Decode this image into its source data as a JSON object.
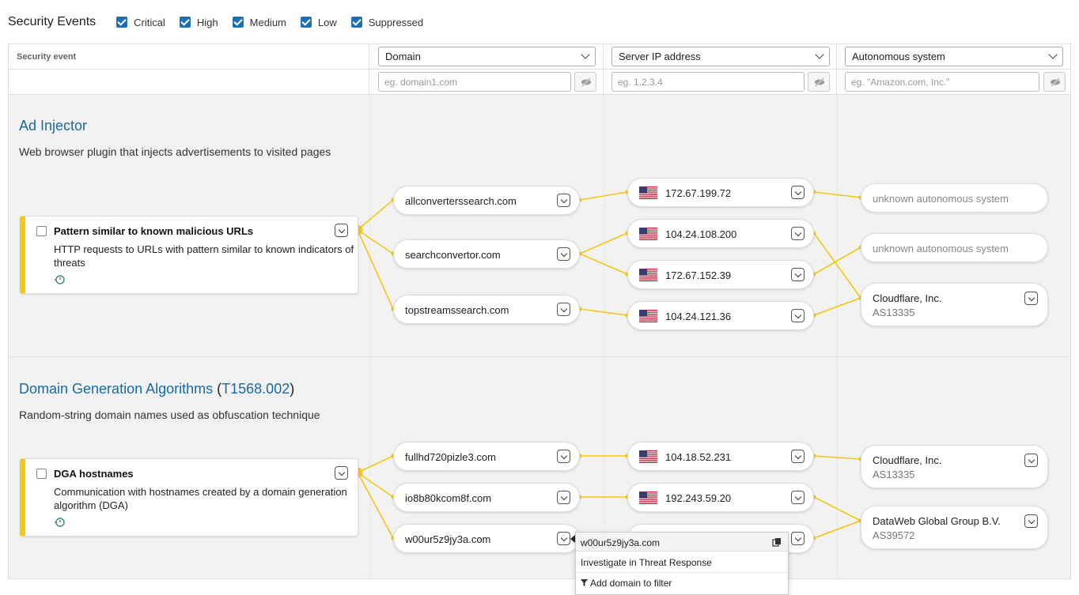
{
  "header": {
    "title": "Security Events",
    "filters": [
      "Critical",
      "High",
      "Medium",
      "Low",
      "Suppressed"
    ]
  },
  "table": {
    "col_security_event": "Security event",
    "col_domain": "Domain",
    "col_server_ip": "Server IP address",
    "col_as": "Autonomous system",
    "ph_domain": "eg. domain1.com",
    "ph_ip": "eg. 1.2.3.4",
    "ph_as": "eg. \"Amazon.com, Inc.\""
  },
  "sections": [
    {
      "title": "Ad Injector",
      "description": "Web browser plugin that injects advertisements to visited pages",
      "event": {
        "name": "Pattern similar to known malicious URLs",
        "description": "HTTP requests to URLs with pattern similar to known indicators of threats"
      },
      "domains": [
        "allconverterssearch.com",
        "searchconvertor.com",
        "topstreamssearch.com"
      ],
      "ips": [
        "172.67.199.72",
        "104.24.108.200",
        "172.67.152.39",
        "104.24.121.36"
      ],
      "as": [
        {
          "name": "unknown autonomous system",
          "num": ""
        },
        {
          "name": "unknown autonomous system",
          "num": ""
        },
        {
          "name": "Cloudflare, Inc.",
          "num": "AS13335"
        }
      ]
    },
    {
      "title": "Domain Generation Algorithms",
      "title_link": "T1568.002",
      "title_open": "(",
      "title_close": ")",
      "description": "Random-string domain names used as obfuscation technique",
      "event": {
        "name": "DGA hostnames",
        "description": "Communication with hostnames created by a domain generation algorithm (DGA)"
      },
      "domains": [
        "fullhd720pizle3.com",
        "io8b80kcom8f.com",
        "w00ur5z9jy3a.com"
      ],
      "ips": [
        "104.18.52.231",
        "192.243.59.20"
      ],
      "as": [
        {
          "name": "Cloudflare, Inc.",
          "num": "AS13335"
        },
        {
          "name": "DataWeb Global Group B.V.",
          "num": "AS39572"
        }
      ]
    }
  ],
  "popup": {
    "domain": "w00ur5z9jy3a.com",
    "items": [
      "Investigate in Threat Response",
      "Add domain to filter"
    ]
  },
  "colors": {
    "accent": "#f5c518",
    "link": "#1a6aa1",
    "checkbox": "#1f6fb5"
  }
}
